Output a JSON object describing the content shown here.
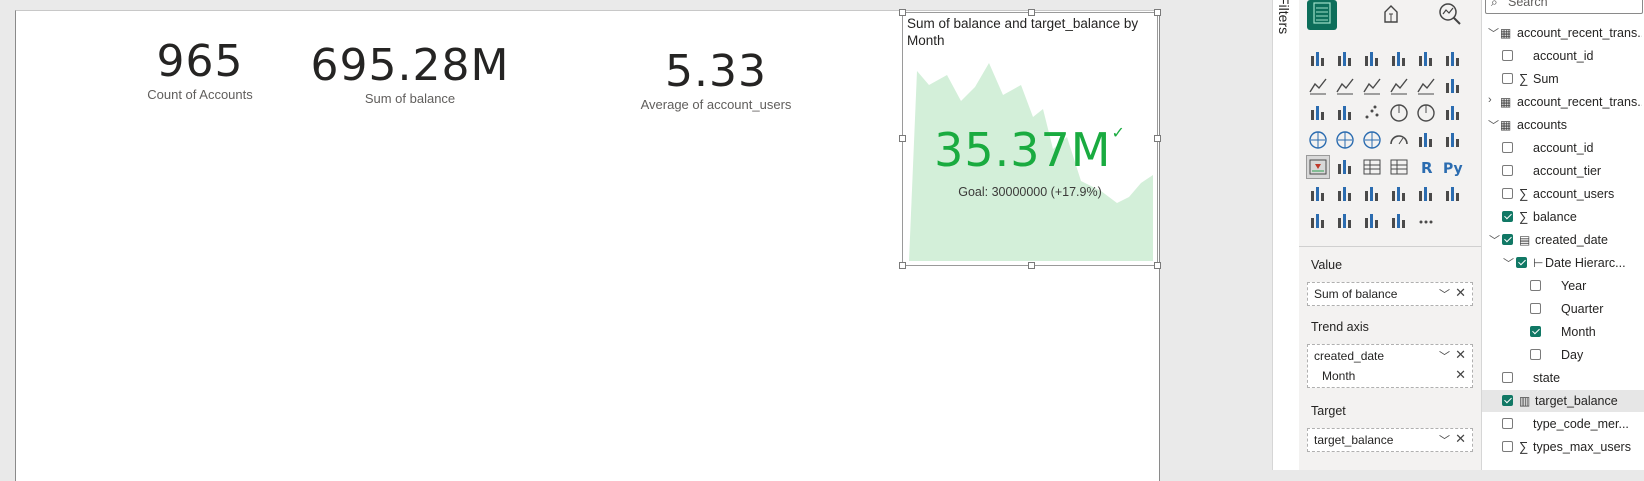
{
  "cards": [
    {
      "value": "965",
      "label": "Count of Accounts"
    },
    {
      "value": "695.28M",
      "label": "Sum of balance"
    },
    {
      "value": "5.33",
      "label": "Average of account_users"
    }
  ],
  "kpi": {
    "title": "Sum of balance and target_balance by Month",
    "value": "35.37M",
    "check": "✓",
    "goal": "Goal: 30000000 (+17.9%)",
    "trend_color": "#d3efd9",
    "value_color": "#1aab40"
  },
  "filters_pane": {
    "label": "Filters"
  },
  "viz_pane": {
    "wells": [
      {
        "label": "Value",
        "fields": [
          {
            "name": "Sum of balance",
            "dropdown": true
          }
        ]
      },
      {
        "label": "Trend axis",
        "fields": [
          {
            "name": "created_date",
            "dropdown": true
          },
          {
            "name": "Month",
            "dropdown": false
          }
        ]
      },
      {
        "label": "Target",
        "fields": [
          {
            "name": "target_balance",
            "dropdown": true
          }
        ]
      }
    ],
    "more_label": "···"
  },
  "fields_pane": {
    "search_placeholder": "Search",
    "items": [
      {
        "label": "account_recent_trans...",
        "kind": "table",
        "level": 0,
        "expanded": true
      },
      {
        "label": "account_id",
        "kind": "field",
        "level": 1,
        "checked": false
      },
      {
        "label": "Sum",
        "kind": "measure",
        "level": 1,
        "checked": false
      },
      {
        "label": "account_recent_trans...",
        "kind": "table",
        "level": 0,
        "expanded": false
      },
      {
        "label": "accounts",
        "kind": "table",
        "level": 0,
        "expanded": true
      },
      {
        "label": "account_id",
        "kind": "field",
        "level": 1,
        "checked": false
      },
      {
        "label": "account_tier",
        "kind": "field",
        "level": 1,
        "checked": false
      },
      {
        "label": "account_users",
        "kind": "measure",
        "level": 1,
        "checked": false
      },
      {
        "label": "balance",
        "kind": "measure",
        "level": 1,
        "checked": true
      },
      {
        "label": "created_date",
        "kind": "date",
        "level": 1,
        "checked": true
      },
      {
        "label": "Date Hierarc...",
        "kind": "hierarchy",
        "level": 2,
        "checked": true
      },
      {
        "label": "Year",
        "kind": "field",
        "level": 3,
        "checked": false
      },
      {
        "label": "Quarter",
        "kind": "field",
        "level": 3,
        "checked": false
      },
      {
        "label": "Month",
        "kind": "field",
        "level": 3,
        "checked": true
      },
      {
        "label": "Day",
        "kind": "field",
        "level": 3,
        "checked": false
      },
      {
        "label": "state",
        "kind": "field",
        "level": 1,
        "checked": false
      },
      {
        "label": "target_balance",
        "kind": "calc",
        "level": 1,
        "checked": true,
        "highlight": true
      },
      {
        "label": "type_code_mer...",
        "kind": "field",
        "level": 1,
        "checked": false
      },
      {
        "label": "types_max_users",
        "kind": "measure",
        "level": 1,
        "checked": false
      }
    ]
  }
}
